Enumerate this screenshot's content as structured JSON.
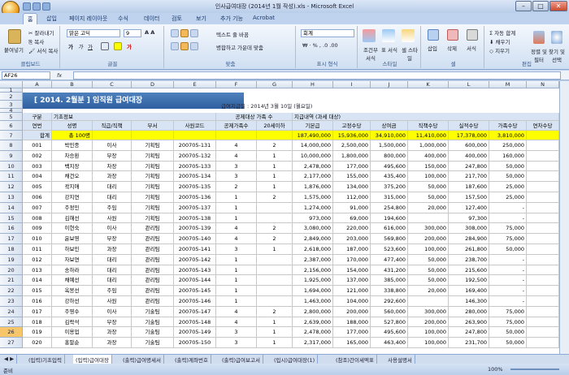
{
  "window": {
    "title": "인사급여대장 (2014년 1월 작성).xls - Microsoft Excel"
  },
  "ribbon": {
    "tabs": [
      "홈",
      "삽입",
      "페이지 레이아웃",
      "수식",
      "데이터",
      "검토",
      "보기",
      "추가 기능",
      "Acrobat"
    ],
    "clipboard": {
      "paste": "붙여넣기",
      "cut": "잘라내기",
      "copy": "복사",
      "format": "서식 복사",
      "label": "클립보드"
    },
    "font": {
      "name": "맑은 고딕",
      "size": "9",
      "label": "글꼴"
    },
    "align": {
      "wrap": "텍스트 줄 바꿈",
      "merge": "병합하고 가운데 맞춤",
      "label": "맞춤"
    },
    "number": {
      "format": "회계",
      "label": "표시 형식"
    },
    "styles": {
      "cond": "조건부 서식",
      "table": "표 서식",
      "cell": "셀 스타일",
      "label": "스타일"
    },
    "cells": {
      "insert": "삽입",
      "delete": "삭제",
      "format": "서식",
      "label": "셀"
    },
    "edit": {
      "autosum": "자동 합계",
      "fill": "채우기",
      "clear": "지우기",
      "sort": "정렬 및 필터",
      "find": "찾기 및 선택",
      "label": "편집"
    }
  },
  "formula": {
    "namebox": "AF26",
    "fx": "fx"
  },
  "columns": [
    "A",
    "B",
    "C",
    "D",
    "E",
    "F",
    "G",
    "H",
    "I",
    "J",
    "K",
    "L",
    "M",
    "N"
  ],
  "sheet": {
    "banner": "[ 2014. 2월분 ]  임직원 급여대장",
    "paydate": "급여지급일 : 2014년 3월 10일 (월요일)",
    "grp_basic": "기초정보",
    "grp_deduct": "공제대상 가족 수",
    "grp_pay": "지급내역 (과세 대상)",
    "gubun": "구분",
    "headers": [
      "연번",
      "성명",
      "직급/직책",
      "부서",
      "사원코드",
      "공제가족수",
      "20세이하",
      "기본급",
      "고정수당",
      "상여금",
      "직책수당",
      "실적수당",
      "가족수당",
      "연차수당"
    ],
    "totals": [
      "합계",
      "총 100명",
      "",
      "",
      "",
      "",
      "",
      "187,490,000",
      "15,936,000",
      "34,910,000",
      "11,410,000",
      "17,378,000",
      "3,810,000",
      ""
    ],
    "rows": [
      [
        "001",
        "박민종",
        "이사",
        "기획팀",
        "200705-131",
        "4",
        "2",
        "14,000,000",
        "2,500,000",
        "1,500,000",
        "1,000,000",
        "600,000",
        "250,000",
        ""
      ],
      [
        "002",
        "차승환",
        "부장",
        "기획팀",
        "200705-132",
        "4",
        "1",
        "10,000,000",
        "1,800,000",
        "800,000",
        "400,000",
        "400,000",
        "160,000",
        ""
      ],
      [
        "003",
        "백지장",
        "차장",
        "기획팀",
        "200705-133",
        "3",
        "1",
        "2,478,000",
        "177,000",
        "495,600",
        "150,000",
        "247,800",
        "50,000",
        ""
      ],
      [
        "004",
        "채건오",
        "과장",
        "기획팀",
        "200705-134",
        "3",
        "1",
        "2,177,000",
        "155,000",
        "435,400",
        "100,000",
        "217,700",
        "50,000",
        ""
      ],
      [
        "005",
        "곽지애",
        "대리",
        "기획팀",
        "200705-135",
        "2",
        "1",
        "1,876,000",
        "134,000",
        "375,200",
        "50,000",
        "187,600",
        "25,000",
        ""
      ],
      [
        "006",
        "강지연",
        "대리",
        "기획팀",
        "200705-136",
        "1",
        "2",
        "1,575,000",
        "112,000",
        "315,000",
        "50,000",
        "157,500",
        "25,000",
        ""
      ],
      [
        "007",
        "주정민",
        "주임",
        "기획팀",
        "200705-137",
        "1",
        "",
        "1,274,000",
        "91,000",
        "254,800",
        "20,000",
        "127,400",
        "-",
        ""
      ],
      [
        "008",
        "김해선",
        "사원",
        "기획팀",
        "200705-138",
        "1",
        "",
        "973,000",
        "69,000",
        "194,600",
        "",
        "97,300",
        "-",
        ""
      ],
      [
        "009",
        "이현숙",
        "이사",
        "관리팀",
        "200705-139",
        "4",
        "2",
        "3,080,000",
        "220,000",
        "616,000",
        "300,000",
        "308,000",
        "75,000",
        ""
      ],
      [
        "010",
        "윤보영",
        "부장",
        "관리팀",
        "200705-140",
        "4",
        "2",
        "2,849,000",
        "203,000",
        "569,800",
        "200,000",
        "284,900",
        "75,000",
        ""
      ],
      [
        "011",
        "하보민",
        "과장",
        "관리팀",
        "200705-141",
        "3",
        "1",
        "2,618,000",
        "187,000",
        "523,600",
        "100,000",
        "261,800",
        "50,000",
        ""
      ],
      [
        "012",
        "자보연",
        "대리",
        "관리팀",
        "200705-142",
        "1",
        "",
        "2,387,000",
        "170,000",
        "477,400",
        "50,000",
        "238,700",
        "-",
        ""
      ],
      [
        "013",
        "송하라",
        "대리",
        "관리팀",
        "200705-143",
        "1",
        "",
        "2,156,000",
        "154,000",
        "431,200",
        "50,000",
        "215,600",
        "-",
        ""
      ],
      [
        "014",
        "채예선",
        "대리",
        "관리팀",
        "200705-144",
        "1",
        "",
        "1,925,000",
        "137,000",
        "385,000",
        "50,000",
        "192,500",
        "-",
        ""
      ],
      [
        "015",
        "옥봉선",
        "주임",
        "관리팀",
        "200705-145",
        "1",
        "",
        "1,694,000",
        "121,000",
        "338,800",
        "20,000",
        "169,400",
        "-",
        ""
      ],
      [
        "016",
        "강하선",
        "사원",
        "관리팀",
        "200705-146",
        "1",
        "",
        "1,463,000",
        "104,000",
        "292,600",
        "",
        "146,300",
        "-",
        ""
      ],
      [
        "017",
        "주영수",
        "이사",
        "기술팀",
        "200705-147",
        "4",
        "2",
        "2,800,000",
        "200,000",
        "560,000",
        "300,000",
        "280,000",
        "75,000",
        ""
      ],
      [
        "018",
        "김락석",
        "부장",
        "기술팀",
        "200705-148",
        "4",
        "1",
        "2,639,000",
        "188,000",
        "527,800",
        "200,000",
        "263,900",
        "75,000",
        ""
      ],
      [
        "019",
        "이용업",
        "과장",
        "기술팀",
        "200705-149",
        "3",
        "1",
        "2,478,000",
        "177,000",
        "495,600",
        "100,000",
        "247,800",
        "50,000",
        ""
      ],
      [
        "020",
        "홍말순",
        "과장",
        "기술팀",
        "200705-150",
        "3",
        "1",
        "2,317,000",
        "165,000",
        "463,400",
        "100,000",
        "231,700",
        "50,000",
        ""
      ]
    ]
  },
  "sheettabs": [
    "(입력)기초입력",
    "(입력)급여대장",
    "(출력)급여명세서",
    "(출력)계좌번호",
    "(출력)급여보고서",
    "(입시)급여대장(1)",
    "(참조)간이세액표",
    "사용설명서"
  ],
  "status": {
    "ready": "준비",
    "zoom": "100%"
  }
}
